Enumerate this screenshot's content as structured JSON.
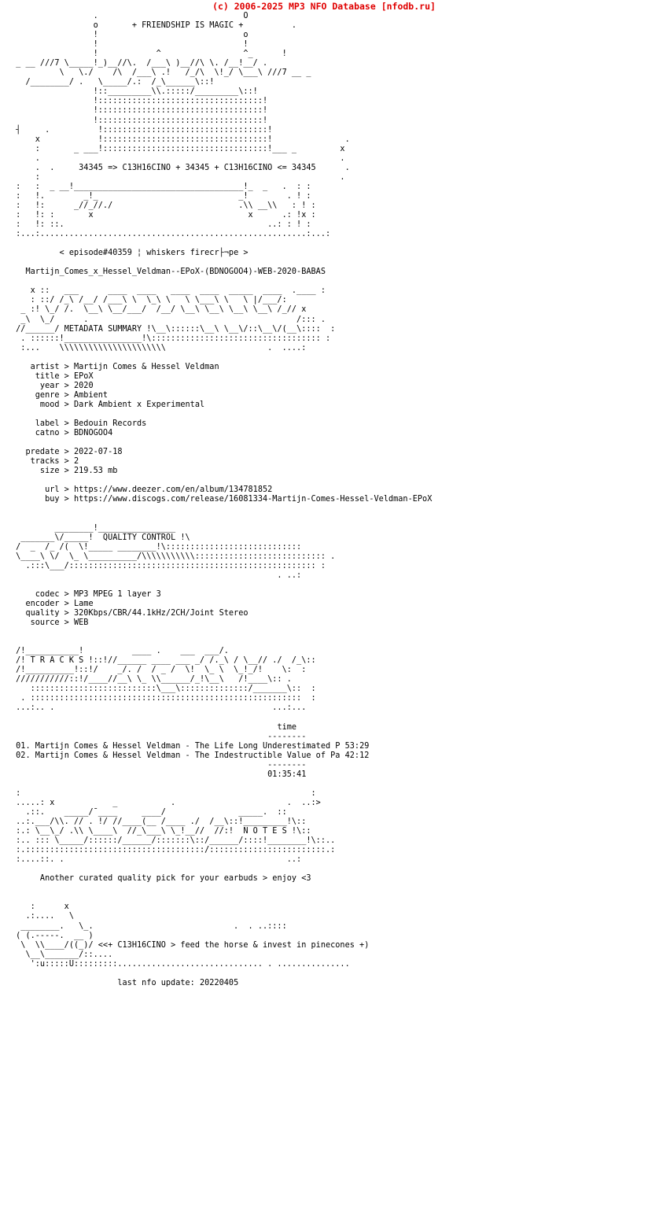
{
  "header": {
    "copyright": "(c) 2006-2025 MP3 NFO Database [nfodb.ru]",
    "copyright_color": "#e00000",
    "group_tagline": "+ FRIENDSHIP IS MAGIC +",
    "equation_line": "34345 => C13H16CINO + 34345 + C13H16CINO <= 34345",
    "episode_line": "< episode#40359 ¦ whiskers firecr├¬pe >",
    "release_name": "Martijn_Comes_x_Hessel_Veldman--EPoX-(BDNOGOO4)-WEB-2020-BABAS"
  },
  "banners": {
    "metadata": "METADATA SUMMARY",
    "quality": "QUALITY CONTROL",
    "tracks": "T R A C K S",
    "notes": "N O T E S"
  },
  "metadata": {
    "fields": [
      {
        "label": "artist",
        "sep": ">",
        "value": "Martijn Comes & Hessel Veldman"
      },
      {
        "label": "title",
        "sep": ">",
        "value": "EPoX"
      },
      {
        "label": "year",
        "sep": ">",
        "value": "2020"
      },
      {
        "label": "genre",
        "sep": ">",
        "value": "Ambient"
      },
      {
        "label": "mood",
        "sep": ">",
        "value": "Dark Ambient x Experimental"
      },
      {
        "label": "label",
        "sep": ">",
        "value": "Bedouin Records"
      },
      {
        "label": "catno",
        "sep": ">",
        "value": "BDNOGOO4"
      },
      {
        "label": "predate",
        "sep": ">",
        "value": "2022-07-18"
      },
      {
        "label": "tracks",
        "sep": ">",
        "value": "2"
      },
      {
        "label": "size",
        "sep": ">",
        "value": "219.53 mb"
      },
      {
        "label": "url",
        "sep": ">",
        "value": "https://www.deezer.com/en/album/134781852"
      },
      {
        "label": "buy",
        "sep": ">",
        "value": "https://www.discogs.com/release/16081334-Martijn-Comes-Hessel-Veldman-EPoX"
      }
    ]
  },
  "quality": {
    "fields": [
      {
        "label": "codec",
        "sep": ">",
        "value": "MP3 MPEG 1 layer 3"
      },
      {
        "label": "encoder",
        "sep": ">",
        "value": "Lame"
      },
      {
        "label": "quality",
        "sep": ">",
        "value": "320Kbps/CBR/44.1kHz/2CH/Joint Stereo"
      },
      {
        "label": "source",
        "sep": ">",
        "value": "WEB"
      }
    ]
  },
  "tracklist": {
    "time_header": "time",
    "rule": "--------",
    "rows": [
      {
        "num": "01.",
        "title": "Martijn Comes & Hessel Veldman - The Life Long Underestimated P",
        "time": "53:29"
      },
      {
        "num": "02.",
        "title": "Martijn Comes & Hessel Veldman - The Indestructible Value of Pa",
        "time": "42:12"
      }
    ],
    "total": "01:35:41"
  },
  "notes": {
    "text": "Another curated quality pick for your earbuds > enjoy <3"
  },
  "footer": {
    "slogan": "<<+ C13H16CINO > feed the horse & invest in pinecones +)",
    "last_update_label": "last nfo update:",
    "last_update_value": "20220405"
  },
  "ascii": {
    "header_art": [
      "                   .                              O",
      "                   O                              .",
      "       + FRIENDSHIP IS MAGIC +                    o",
      "                   o                              !",
      "                   !                              !",
      "                   !                              !"
    ],
    "logo_top": [
      "                      _______/\\           )__//      ___\\     __\\            . /",
      "  _ __ ///7 \\_____\\ /   //\\  /__/ \\__\\ /  )__/ /\\  \\ ./_\\/_\\/__\\  __",
      " //________/  .    /\\.::::/_________\\\\.:::::/________\\::",
      "     ::::::::::::::::::::::::::::::::::::::::::::::",
      "     ::::::::::::::::::::::::::::::::::::::::::::::"
    ],
    "side_marks": {
      "left": "┤",
      "x": "x",
      "dot": "."
    }
  }
}
